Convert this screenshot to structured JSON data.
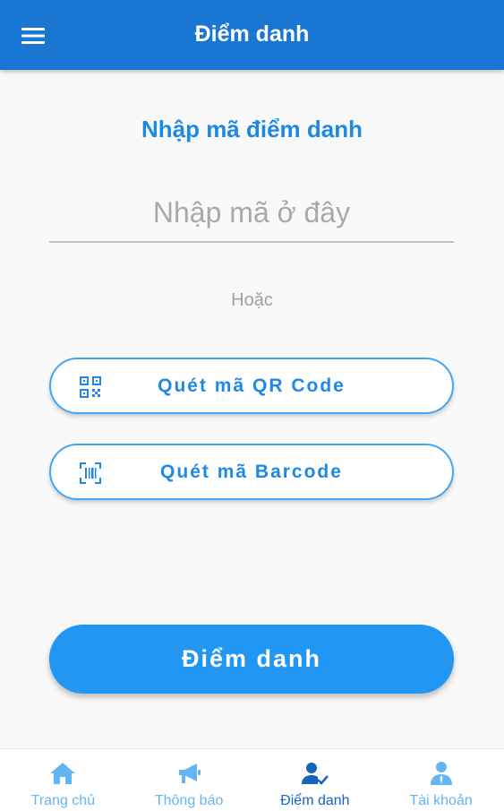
{
  "appbar": {
    "title": "Điểm danh"
  },
  "main": {
    "heading": "Nhập mã điểm danh",
    "code_input": {
      "placeholder": "Nhập mã ở đây",
      "value": ""
    },
    "or_text": "Hoặc",
    "scan_qr": {
      "label": "Quét mã QR Code",
      "icon": "qr-code-icon"
    },
    "scan_barcode": {
      "label": "Quét mã Barcode",
      "icon": "barcode-icon"
    },
    "submit_label": "Điểm danh"
  },
  "bottom_nav": {
    "items": [
      {
        "label": "Trang chủ",
        "icon": "home-icon",
        "active": false
      },
      {
        "label": "Thông báo",
        "icon": "megaphone-icon",
        "active": false
      },
      {
        "label": "Điểm danh",
        "icon": "user-check-icon",
        "active": true
      },
      {
        "label": "Tài khoản",
        "icon": "account-icon",
        "active": false
      }
    ]
  },
  "colors": {
    "primary": "#1976d2",
    "accent": "#2196f3",
    "text_blue": "#1e88e5",
    "nav_inactive": "#64b5f6",
    "nav_active": "#1565c0",
    "background": "#f9f9f9"
  }
}
